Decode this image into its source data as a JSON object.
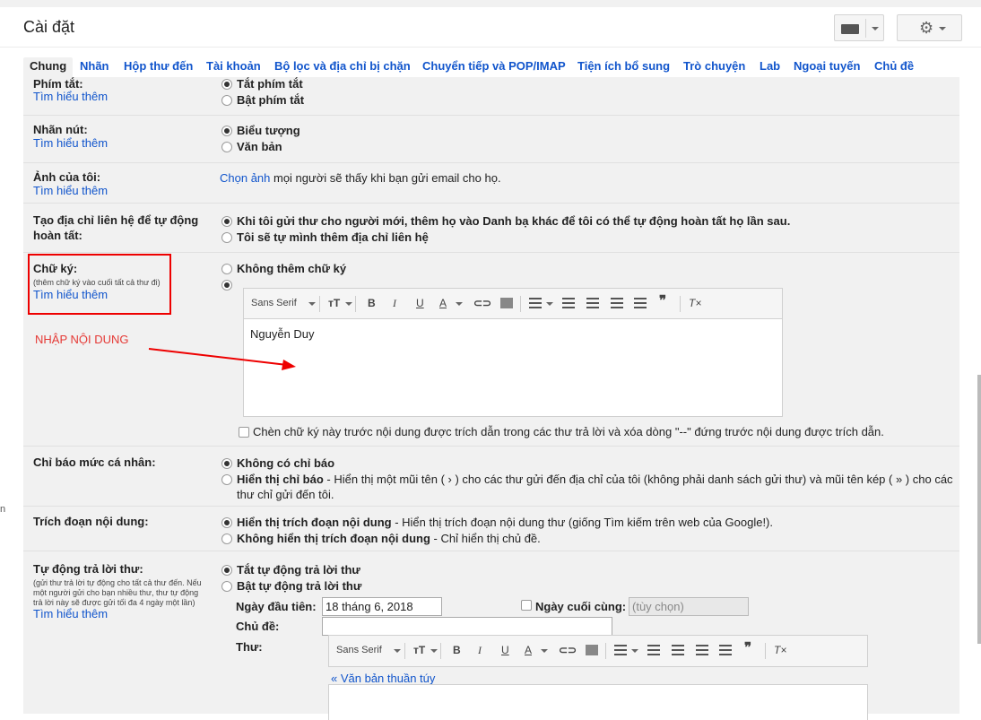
{
  "header": {
    "title": "Cài đặt"
  },
  "tabs": [
    "Chung",
    "Nhãn",
    "Hộp thư đến",
    "Tài khoản",
    "Bộ lọc và địa chỉ bị chặn",
    "Chuyển tiếp và POP/IMAP",
    "Tiện ích bổ sung",
    "Trò chuyện",
    "Lab",
    "Ngoại tuyến",
    "Chủ đề"
  ],
  "learn_more": "Tìm hiểu thêm",
  "shortcuts": {
    "label": "Phím tắt:",
    "opt1": "Tắt phím tắt",
    "opt2": "Bật phím tắt"
  },
  "button_labels": {
    "label": "Nhãn nút:",
    "opt1": "Biểu tượng",
    "opt2": "Văn bản"
  },
  "picture": {
    "label": "Ảnh của tôi:",
    "link": "Chọn ảnh",
    "text": " mọi người sẽ thấy khi bạn gửi email cho họ."
  },
  "autocontacts": {
    "label": "Tạo địa chỉ liên hệ để tự động hoàn tất:",
    "opt1": "Khi tôi gửi thư cho người mới, thêm họ vào Danh bạ khác để tôi có thể tự động hoàn tất họ lần sau.",
    "opt2": "Tôi sẽ tự mình thêm địa chỉ liên hệ"
  },
  "signature": {
    "label": "Chữ ký:",
    "note": "(thêm chữ ký vào cuối tất cả thư đi)",
    "opt1": "Không thêm chữ ký",
    "font": "Sans Serif",
    "content": "Nguyễn Duy",
    "checkbox": "Chèn chữ ký này trước nội dung được trích dẫn trong các thư trả lời và xóa dòng \"--\" đứng trước nội dung được trích dẫn."
  },
  "annotation": "NHẬP NỘI DUNG",
  "personal": {
    "label": "Chỉ báo mức cá nhân:",
    "opt1": "Không có chỉ báo",
    "opt2_bold": "Hiển thị chỉ báo",
    "opt2_text": " - Hiển thị một mũi tên ( › ) cho các thư gửi đến địa chỉ của tôi (không phải danh sách gửi thư) và mũi tên kép ( » ) cho các",
    "opt2_text2": "thư chỉ gửi đến tôi."
  },
  "snippets": {
    "label": "Trích đoạn nội dung:",
    "opt1_bold": "Hiển thị trích đoạn nội dung",
    "opt1_text": " - Hiển thị trích đoạn nội dung thư (giống Tìm kiếm trên web của Google!).",
    "opt2_bold": "Không hiển thị trích đoạn nội dung",
    "opt2_text": " - Chỉ hiển thị chủ đề."
  },
  "vacation": {
    "label": "Tự động trả lời thư:",
    "note1": "(gửi thư trả lời tự động cho tất cả thư đến. Nếu",
    "note2": "một người gửi cho bạn nhiều thư, thư tự động",
    "note3": "trả lời này sẽ được gửi tối đa 4 ngày một lần)",
    "opt1": "Tắt tự động trả lời thư",
    "opt2": "Bật tự động trả lời thư",
    "first_day_label": "Ngày đầu tiên:",
    "first_day_value": "18 tháng 6, 2018",
    "last_day_label": "Ngày cuối cùng:",
    "last_day_placeholder": "(tùy chọn)",
    "subject_label": "Chủ đề:",
    "message_label": "Thư:",
    "font": "Sans Serif",
    "plain_text": "« Văn bản thuần túy"
  },
  "left_edge_text": "n"
}
